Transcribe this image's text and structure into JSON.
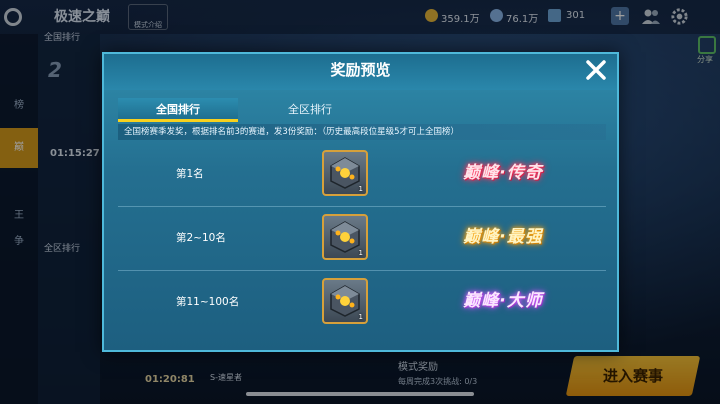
{
  "background": {
    "title": "极速之巅",
    "mode_intro": "模式介绍",
    "coins": "359.1万",
    "diamonds": "76.1万",
    "signal": "301",
    "share_label": "分享",
    "left_tabs": [
      "榜",
      "巅",
      "王",
      "争"
    ],
    "national_rank_header": "全国排行",
    "regional_rank_header": "全区排行",
    "my_rank": "2",
    "my_time": "01:15:27",
    "bottom_time": "01:20:81",
    "bottom_rank_name": "S-速星者",
    "mode_reward": "模式奖励",
    "progress_text": "每周完成3次挑战: 0/3",
    "enter_button": "进入赛事"
  },
  "modal": {
    "title": "奖励预览",
    "close_icon": "close-icon",
    "tabs": [
      {
        "label": "全国排行",
        "active": true
      },
      {
        "label": "全区排行",
        "active": false
      }
    ],
    "notice": "全国榜赛季发奖，根据排名前3的赛道，发3份奖励：（历史最高段位星级5才可上全国榜）",
    "rewards": [
      {
        "rank": "第1名",
        "item_count": "1",
        "title": "巅峰·传奇"
      },
      {
        "rank": "第2~10名",
        "item_count": "1",
        "title": "巅峰·最强"
      },
      {
        "rank": "第11~100名",
        "item_count": "1",
        "title": "巅峰·大师"
      }
    ]
  }
}
